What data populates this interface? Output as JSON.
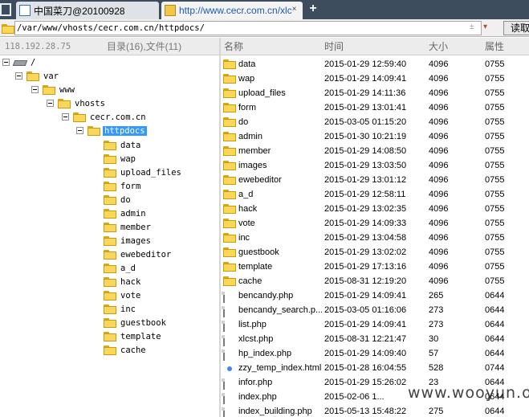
{
  "tabs": [
    {
      "title": "中国菜刀@20100928",
      "active": false
    },
    {
      "title": "http://www.cecr.com.cn/xlcs...",
      "active": true
    }
  ],
  "addtab_label": "+",
  "tab_close_label": "×",
  "address": {
    "path": "/var/www/vhosts/cecr.com.cn/httpdocs/",
    "dropdown_symbol": "±",
    "dropdown_arrow": "▾",
    "read_button": "读取"
  },
  "left_header": {
    "ip": "118.192.28.75",
    "counts": "目录(16),文件(11)"
  },
  "columns": {
    "name": "名称",
    "time": "时间",
    "size": "大小",
    "perm": "属性"
  },
  "tree": {
    "root": "/",
    "var": "var",
    "www": "www",
    "vhosts": "vhosts",
    "domain": "cecr.com.cn",
    "httpdocs": "httpdocs",
    "children": [
      "data",
      "wap",
      "upload_files",
      "form",
      "do",
      "admin",
      "member",
      "images",
      "ewebeditor",
      "a_d",
      "hack",
      "vote",
      "inc",
      "guestbook",
      "template",
      "cache"
    ]
  },
  "files": [
    {
      "name": "data",
      "time": "2015-01-29 12:59:40",
      "size": "4096",
      "perm": "0755",
      "type": "folder"
    },
    {
      "name": "wap",
      "time": "2015-01-29 14:09:41",
      "size": "4096",
      "perm": "0755",
      "type": "folder"
    },
    {
      "name": "upload_files",
      "time": "2015-01-29 14:11:36",
      "size": "4096",
      "perm": "0755",
      "type": "folder"
    },
    {
      "name": "form",
      "time": "2015-01-29 13:01:41",
      "size": "4096",
      "perm": "0755",
      "type": "folder"
    },
    {
      "name": "do",
      "time": "2015-03-05 01:15:20",
      "size": "4096",
      "perm": "0755",
      "type": "folder"
    },
    {
      "name": "admin",
      "time": "2015-01-30 10:21:19",
      "size": "4096",
      "perm": "0755",
      "type": "folder"
    },
    {
      "name": "member",
      "time": "2015-01-29 14:08:50",
      "size": "4096",
      "perm": "0755",
      "type": "folder"
    },
    {
      "name": "images",
      "time": "2015-01-29 13:03:50",
      "size": "4096",
      "perm": "0755",
      "type": "folder"
    },
    {
      "name": "ewebeditor",
      "time": "2015-01-29 13:01:12",
      "size": "4096",
      "perm": "0755",
      "type": "folder"
    },
    {
      "name": "a_d",
      "time": "2015-01-29 12:58:11",
      "size": "4096",
      "perm": "0755",
      "type": "folder"
    },
    {
      "name": "hack",
      "time": "2015-01-29 13:02:35",
      "size": "4096",
      "perm": "0755",
      "type": "folder"
    },
    {
      "name": "vote",
      "time": "2015-01-29 14:09:33",
      "size": "4096",
      "perm": "0755",
      "type": "folder"
    },
    {
      "name": "inc",
      "time": "2015-01-29 13:04:58",
      "size": "4096",
      "perm": "0755",
      "type": "folder"
    },
    {
      "name": "guestbook",
      "time": "2015-01-29 13:02:02",
      "size": "4096",
      "perm": "0755",
      "type": "folder"
    },
    {
      "name": "template",
      "time": "2015-01-29 17:13:16",
      "size": "4096",
      "perm": "0755",
      "type": "folder"
    },
    {
      "name": "cache",
      "time": "2015-08-31 12:19:20",
      "size": "4096",
      "perm": "0755",
      "type": "folder"
    },
    {
      "name": "bencandy.php",
      "time": "2015-01-29 14:09:41",
      "size": "265",
      "perm": "0644",
      "type": "file"
    },
    {
      "name": "bencandy_search.p...",
      "time": "2015-03-05 01:16:06",
      "size": "273",
      "perm": "0644",
      "type": "file"
    },
    {
      "name": "list.php",
      "time": "2015-01-29 14:09:41",
      "size": "273",
      "perm": "0644",
      "type": "file"
    },
    {
      "name": "xlcst.php",
      "time": "2015-08-31 12:21:47",
      "size": "30",
      "perm": "0644",
      "type": "file"
    },
    {
      "name": "hp_index.php",
      "time": "2015-01-29 14:09:40",
      "size": "57",
      "perm": "0644",
      "type": "file"
    },
    {
      "name": "zzy_temp_index.html",
      "time": "2015-01-28 16:04:55",
      "size": "528",
      "perm": "0744",
      "type": "html"
    },
    {
      "name": "infor.php",
      "time": "2015-01-29 15:26:02",
      "size": "23",
      "perm": "0644",
      "type": "file"
    },
    {
      "name": "index.php",
      "time": "2015-02-06 1...",
      "size": "",
      "perm": "0644",
      "type": "file"
    },
    {
      "name": "index_building.php",
      "time": "2015-05-13 15:48:22",
      "size": "275",
      "perm": "0644",
      "type": "file"
    }
  ],
  "watermark": "www.wooyun.org",
  "colors": {
    "tabbar": "#3d4d5e",
    "selection": "#3399ff",
    "folder": "#f9d75a"
  }
}
